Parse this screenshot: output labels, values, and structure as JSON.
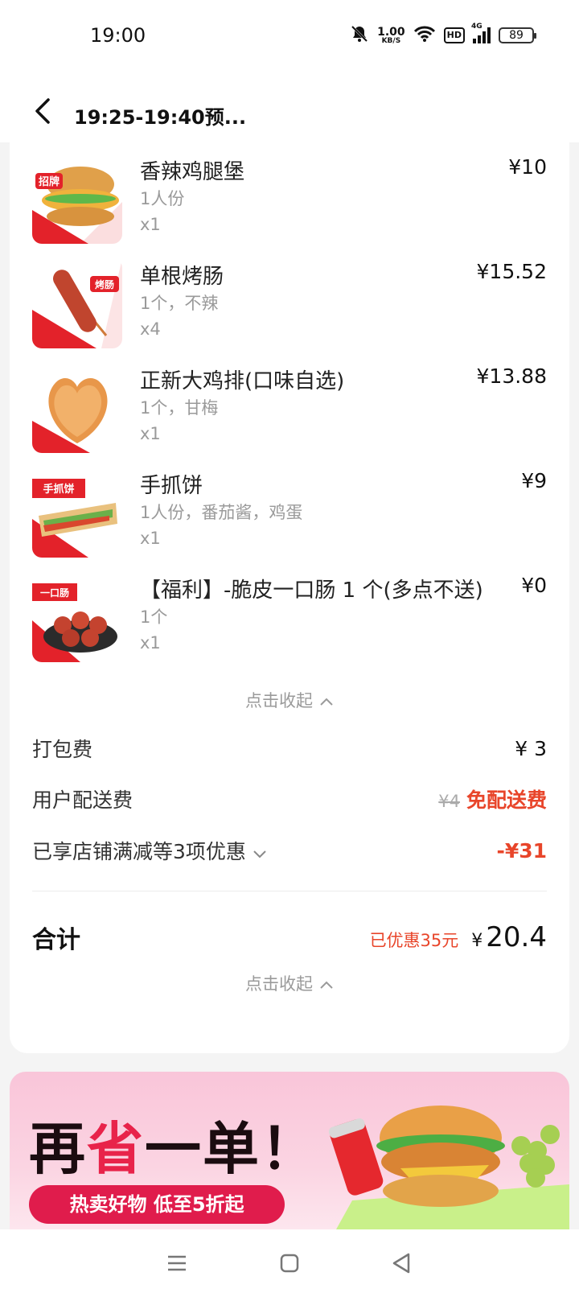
{
  "status_bar": {
    "time": "19:00",
    "net_speed_value": "1.00",
    "net_speed_unit": "KB/S",
    "hd_label": "HD",
    "signal_label": "4G",
    "battery": "89"
  },
  "header": {
    "title": "19:25-19:40预..."
  },
  "items": [
    {
      "name": "香辣鸡腿堡",
      "spec": "1人份",
      "qty": "x1",
      "price": "¥10",
      "image_icon": "burger-thumbnail",
      "badge": "招牌"
    },
    {
      "name": "单根烤肠",
      "spec": "1个，不辣",
      "qty": "x4",
      "price": "¥15.52",
      "image_icon": "sausage-thumbnail",
      "badge": "烤肠"
    },
    {
      "name": "正新大鸡排(口味自选)",
      "spec": "1个，甘梅",
      "qty": "x1",
      "price": "¥13.88",
      "image_icon": "chicken-cutlet-thumbnail",
      "badge": ""
    },
    {
      "name": "手抓饼",
      "spec": "1人份，番茄酱，鸡蛋",
      "qty": "x1",
      "price": "¥9",
      "image_icon": "wrap-thumbnail",
      "badge": "手抓饼"
    },
    {
      "name": "【福利】-脆皮一口肠 1 个(多点不送)",
      "spec": "1个",
      "qty": "x1",
      "price": "¥0",
      "image_icon": "mini-sausage-thumbnail",
      "badge": "一口肠"
    }
  ],
  "collapse_label": "点击收起",
  "fees": {
    "packing_label": "打包费",
    "packing_value": "¥ 3",
    "delivery_label": "用户配送费",
    "delivery_original": "¥4",
    "delivery_value": "免配送费",
    "discount_label": "已享店铺满减等3项优惠",
    "discount_value": "-¥31"
  },
  "total": {
    "label": "合计",
    "saved": "已优惠35元",
    "currency": "¥",
    "amount": "20.4"
  },
  "banner": {
    "title_part1": "再",
    "title_highlight": "省",
    "title_part2": "一单！",
    "pill": "热卖好物 低至5折起"
  },
  "colors": {
    "accent_red": "#e8452a",
    "banner_pink": "#f9c5d9",
    "pill_red": "#e01c4c"
  }
}
